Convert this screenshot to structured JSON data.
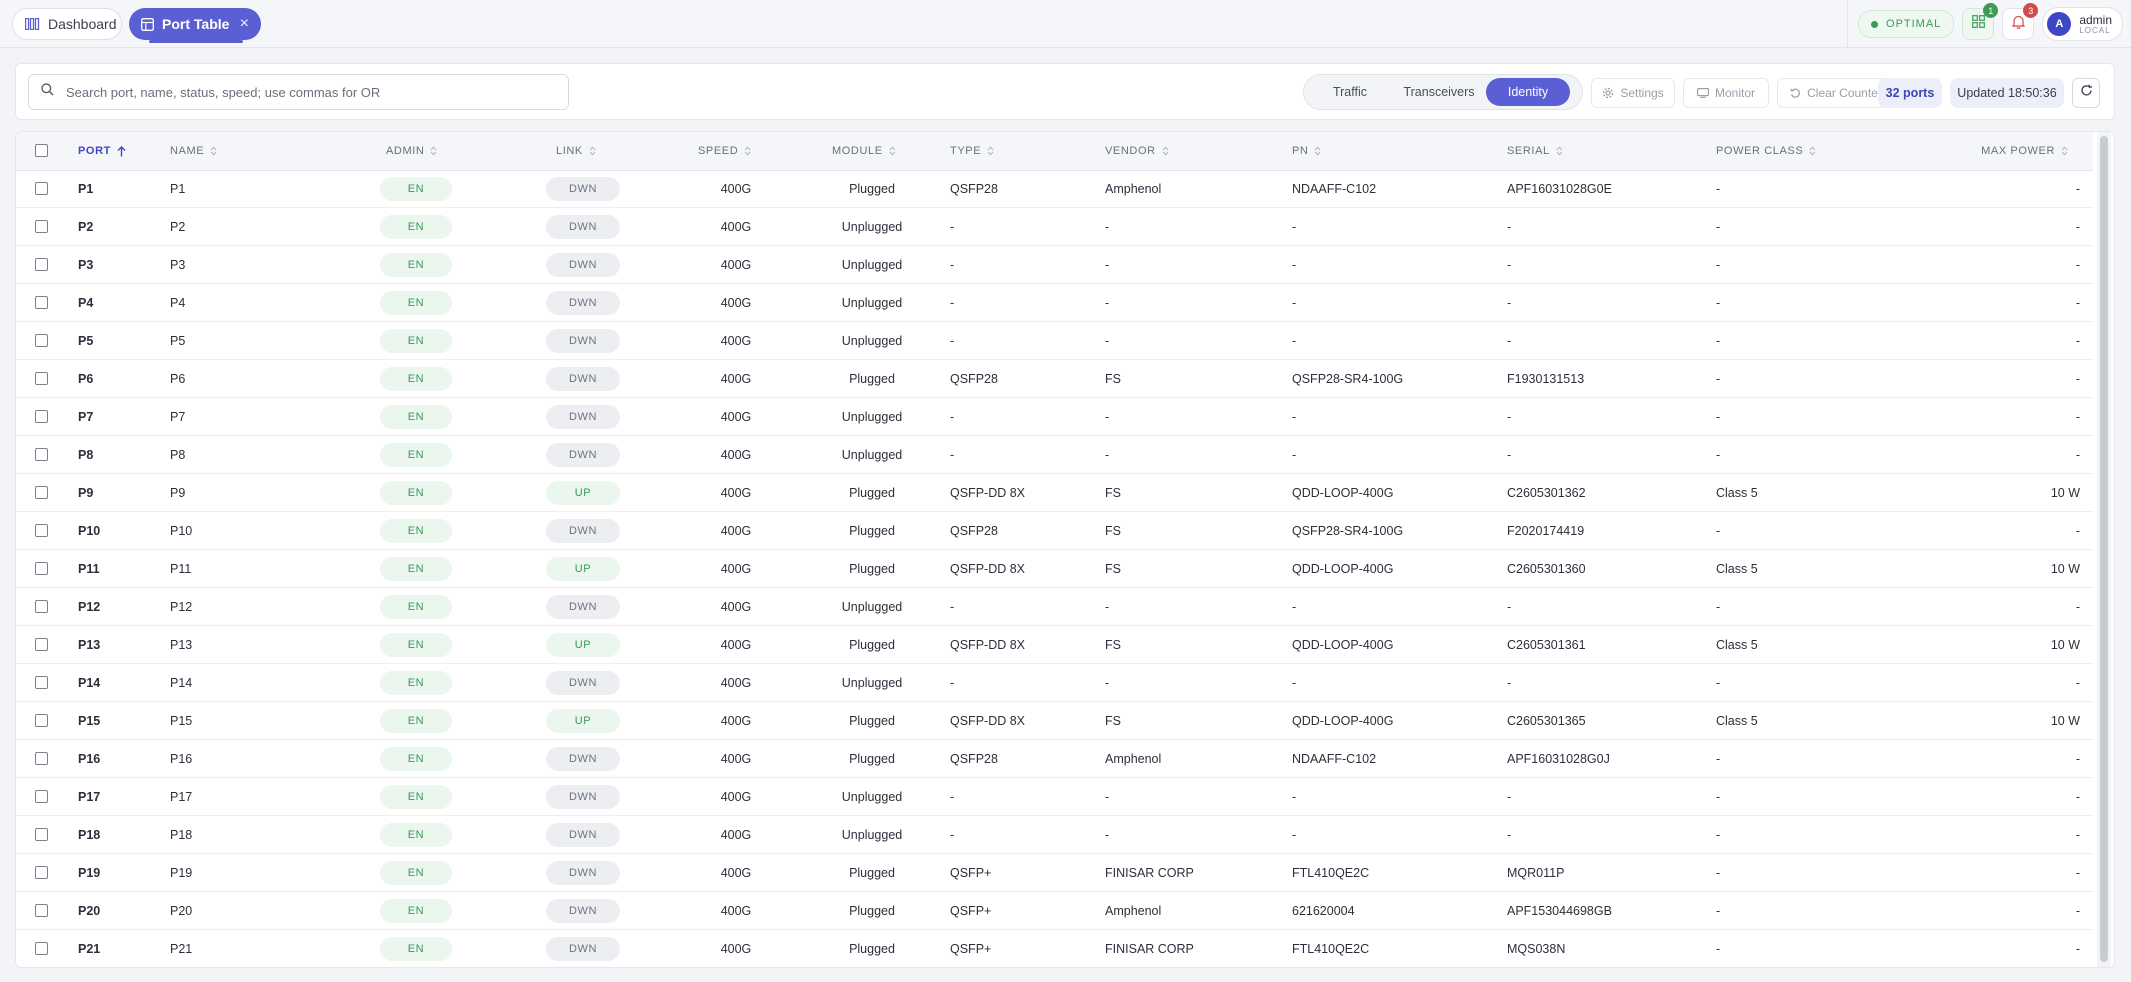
{
  "tabs": {
    "dashboard": "Dashboard",
    "port_table": "Port Table",
    "close": "×"
  },
  "status": {
    "optimal": "OPTIMAL"
  },
  "badges": {
    "layout": "1",
    "notifications": "3"
  },
  "user": {
    "initial": "A",
    "name": "admin",
    "role": "LOCAL"
  },
  "toolbar": {
    "search_placeholder": "Search port, name, status, speed; use commas for OR",
    "views": [
      "Traffic",
      "Transceivers",
      "Identity"
    ],
    "active_view": "Identity",
    "settings": "Settings",
    "monitor": "Monitor",
    "clear_counters": "Clear Counters",
    "ports_count": "32 ports",
    "updated": "Updated 18:50:36"
  },
  "colors": {
    "accent": "#5a5fd4",
    "enabled": "#3a9a58",
    "down": "#6e7280"
  },
  "table": {
    "columns": [
      "PORT",
      "NAME",
      "ADMIN",
      "LINK",
      "SPEED",
      "MODULE",
      "TYPE",
      "VENDOR",
      "PN",
      "SERIAL",
      "POWER CLASS",
      "MAX POWER"
    ],
    "sorted_column": "PORT",
    "rows": [
      [
        "P1",
        "P1",
        "EN",
        "DWN",
        "400G",
        "Plugged",
        "QSFP28",
        "Amphenol",
        "NDAAFF-C102",
        "APF16031028G0E",
        "-",
        "-"
      ],
      [
        "P2",
        "P2",
        "EN",
        "DWN",
        "400G",
        "Unplugged",
        "-",
        "-",
        "-",
        "-",
        "-",
        "-"
      ],
      [
        "P3",
        "P3",
        "EN",
        "DWN",
        "400G",
        "Unplugged",
        "-",
        "-",
        "-",
        "-",
        "-",
        "-"
      ],
      [
        "P4",
        "P4",
        "EN",
        "DWN",
        "400G",
        "Unplugged",
        "-",
        "-",
        "-",
        "-",
        "-",
        "-"
      ],
      [
        "P5",
        "P5",
        "EN",
        "DWN",
        "400G",
        "Unplugged",
        "-",
        "-",
        "-",
        "-",
        "-",
        "-"
      ],
      [
        "P6",
        "P6",
        "EN",
        "DWN",
        "400G",
        "Plugged",
        "QSFP28",
        "FS",
        "QSFP28-SR4-100G",
        "F1930131513",
        "-",
        "-"
      ],
      [
        "P7",
        "P7",
        "EN",
        "DWN",
        "400G",
        "Unplugged",
        "-",
        "-",
        "-",
        "-",
        "-",
        "-"
      ],
      [
        "P8",
        "P8",
        "EN",
        "DWN",
        "400G",
        "Unplugged",
        "-",
        "-",
        "-",
        "-",
        "-",
        "-"
      ],
      [
        "P9",
        "P9",
        "EN",
        "UP",
        "400G",
        "Plugged",
        "QSFP-DD 8X",
        "FS",
        "QDD-LOOP-400G",
        "C2605301362",
        "Class 5",
        "10 W"
      ],
      [
        "P10",
        "P10",
        "EN",
        "DWN",
        "400G",
        "Plugged",
        "QSFP28",
        "FS",
        "QSFP28-SR4-100G",
        "F2020174419",
        "-",
        "-"
      ],
      [
        "P11",
        "P11",
        "EN",
        "UP",
        "400G",
        "Plugged",
        "QSFP-DD 8X",
        "FS",
        "QDD-LOOP-400G",
        "C2605301360",
        "Class 5",
        "10 W"
      ],
      [
        "P12",
        "P12",
        "EN",
        "DWN",
        "400G",
        "Unplugged",
        "-",
        "-",
        "-",
        "-",
        "-",
        "-"
      ],
      [
        "P13",
        "P13",
        "EN",
        "UP",
        "400G",
        "Plugged",
        "QSFP-DD 8X",
        "FS",
        "QDD-LOOP-400G",
        "C2605301361",
        "Class 5",
        "10 W"
      ],
      [
        "P14",
        "P14",
        "EN",
        "DWN",
        "400G",
        "Unplugged",
        "-",
        "-",
        "-",
        "-",
        "-",
        "-"
      ],
      [
        "P15",
        "P15",
        "EN",
        "UP",
        "400G",
        "Plugged",
        "QSFP-DD 8X",
        "FS",
        "QDD-LOOP-400G",
        "C2605301365",
        "Class 5",
        "10 W"
      ],
      [
        "P16",
        "P16",
        "EN",
        "DWN",
        "400G",
        "Plugged",
        "QSFP28",
        "Amphenol",
        "NDAAFF-C102",
        "APF16031028G0J",
        "-",
        "-"
      ],
      [
        "P17",
        "P17",
        "EN",
        "DWN",
        "400G",
        "Unplugged",
        "-",
        "-",
        "-",
        "-",
        "-",
        "-"
      ],
      [
        "P18",
        "P18",
        "EN",
        "DWN",
        "400G",
        "Unplugged",
        "-",
        "-",
        "-",
        "-",
        "-",
        "-"
      ],
      [
        "P19",
        "P19",
        "EN",
        "DWN",
        "400G",
        "Plugged",
        "QSFP+",
        "FINISAR CORP",
        "FTL410QE2C",
        "MQR011P",
        "-",
        "-"
      ],
      [
        "P20",
        "P20",
        "EN",
        "DWN",
        "400G",
        "Plugged",
        "QSFP+",
        "Amphenol",
        "621620004",
        "APF153044698GB",
        "-",
        "-"
      ],
      [
        "P21",
        "P21",
        "EN",
        "DWN",
        "400G",
        "Plugged",
        "QSFP+",
        "FINISAR CORP",
        "FTL410QE2C",
        "MQS038N",
        "-",
        "-"
      ]
    ]
  }
}
